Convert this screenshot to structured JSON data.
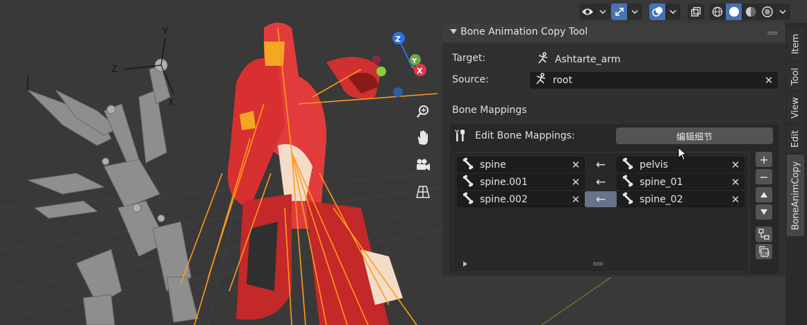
{
  "panel": {
    "title": "Bone Animation Copy Tool",
    "target_label": "Target:",
    "target_value": "Ashtarte_arm",
    "source_label": "Source:",
    "source_value": "root",
    "mappings_heading": "Bone Mappings",
    "edit_label": "Edit Bone Mappings:",
    "edit_button": "编辑细节"
  },
  "mappings": [
    {
      "target": "spine",
      "arrow": "←",
      "source": "pelvis"
    },
    {
      "target": "spine.001",
      "arrow": "←",
      "source": "spine_01"
    },
    {
      "target": "spine.002",
      "arrow": "←",
      "source": "spine_02"
    }
  ],
  "list_buttons": {
    "add": "+",
    "remove": "−"
  },
  "tabs": [
    "Item",
    "Tool",
    "View",
    "Edit",
    "BoneAnimCopy"
  ],
  "active_tab": "BoneAnimCopy",
  "gizmo": {
    "z": "Z",
    "y": "Y",
    "x": "X"
  },
  "icons": {
    "overlay": "eye-icon",
    "gizmo_toggle": "transform-gizmo-icon",
    "viewport_overlay": "overlay-icon",
    "xray": "xray-icon",
    "shading": [
      "wireframe-shading-icon",
      "solid-shading-icon",
      "material-preview-icon",
      "rendered-shading-icon"
    ],
    "nav": [
      "zoom-icon",
      "hand-pan-icon",
      "camera-icon",
      "grid-perspective-icon"
    ],
    "armature": "armature-icon",
    "bone": "bone-icon"
  },
  "colors": {
    "accent": "#4772b3",
    "panel_bg": "#303030",
    "field_bg": "#1d1d1d",
    "selection_orange": "#ff9a1f",
    "character_red": "#d93a3a"
  }
}
